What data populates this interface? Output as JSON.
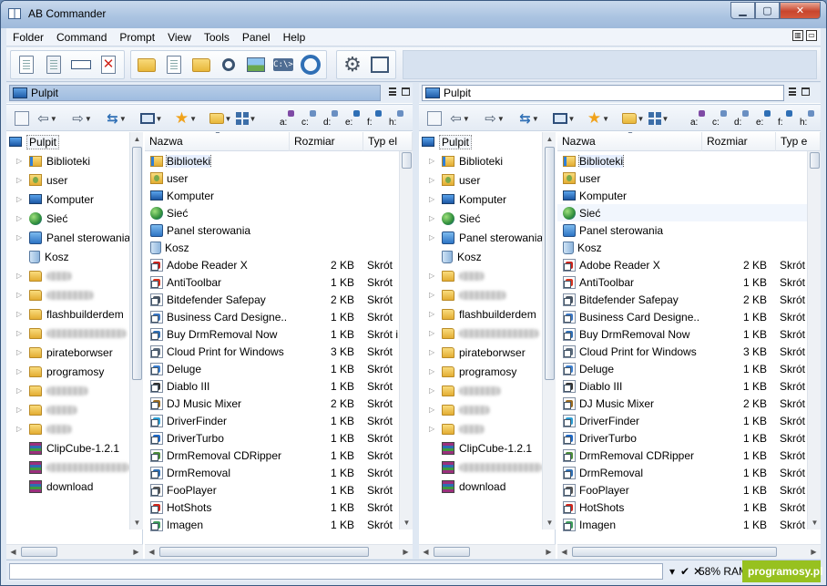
{
  "window": {
    "title": "AB Commander"
  },
  "menu": [
    "Folder",
    "Command",
    "Prompt",
    "View",
    "Tools",
    "Panel",
    "Help"
  ],
  "toolbar_icons": [
    "copy-icon",
    "copy-to-icon",
    "rename-icon",
    "delete-icon",
    "move-up-icon",
    "properties-icon",
    "new-folder-icon",
    "find-icon",
    "image-viewer-icon",
    "command-prompt-icon",
    "sync-icon",
    "settings-icon",
    "fullscreen-icon"
  ],
  "drives": [
    "a:",
    "c:",
    "d:",
    "e:",
    "f:",
    "h:"
  ],
  "left": {
    "path": "Pulpit",
    "tree_root": "Pulpit",
    "tree": [
      "Biblioteki",
      "user",
      "Komputer",
      "Sieć",
      "Panel sterowania",
      "Kosz",
      "",
      "",
      "flashbuilderdem",
      "",
      "pirateborwser",
      "programosy",
      "",
      "",
      "",
      "ClipCube-1.2.1",
      "",
      "download"
    ],
    "columns": [
      "Nazwa",
      "Rozmiar",
      "Typ el"
    ]
  },
  "right": {
    "path": "Pulpit",
    "tree_root": "Pulpit",
    "tree": [
      "Biblioteki",
      "user",
      "Komputer",
      "Sieć",
      "Panel sterowania",
      "Kosz",
      "",
      "",
      "flashbuilderdem",
      "",
      "pirateborwser",
      "programosy",
      "",
      "",
      "",
      "ClipCube-1.2.1",
      "",
      "download"
    ],
    "columns": [
      "Nazwa",
      "Rozmiar",
      "Typ e"
    ]
  },
  "files": [
    {
      "name": "Biblioteki",
      "size": "",
      "type": "",
      "icon": "libs"
    },
    {
      "name": "user",
      "size": "",
      "type": "",
      "icon": "user"
    },
    {
      "name": "Komputer",
      "size": "",
      "type": "",
      "icon": "comp"
    },
    {
      "name": "Sieć",
      "size": "",
      "type": "",
      "icon": "net"
    },
    {
      "name": "Panel sterowania",
      "size": "",
      "type": "",
      "icon": "ctrl"
    },
    {
      "name": "Kosz",
      "size": "",
      "type": "",
      "icon": "bin"
    },
    {
      "name": "Adobe Reader X",
      "size": "2 KB",
      "type": "Skrót",
      "icon": "app",
      "color": "#c9231b"
    },
    {
      "name": "AntiToolbar",
      "size": "1 KB",
      "type": "Skrót",
      "icon": "app",
      "color": "#d8341f"
    },
    {
      "name": "Bitdefender Safepay",
      "size": "2 KB",
      "type": "Skrót",
      "icon": "app",
      "color": "#4a5563"
    },
    {
      "name": "Business Card Designe...",
      "size": "1 KB",
      "type": "Skrót",
      "icon": "app",
      "color": "#3a76c4"
    },
    {
      "name": "Buy DrmRemoval Now",
      "size": "1 KB",
      "type": "Skrót i",
      "icon": "app",
      "color": "#2f6fb5"
    },
    {
      "name": "Cloud Print for Windows",
      "size": "3 KB",
      "type": "Skrót",
      "icon": "app",
      "color": "#5b6b7d"
    },
    {
      "name": "Deluge",
      "size": "1 KB",
      "type": "Skrót",
      "icon": "app",
      "color": "#3b7fd0"
    },
    {
      "name": "Diablo III",
      "size": "1 KB",
      "type": "Skrót",
      "icon": "app",
      "color": "#333"
    },
    {
      "name": "DJ Music Mixer",
      "size": "2 KB",
      "type": "Skrót",
      "icon": "app",
      "color": "#9a6a1e"
    },
    {
      "name": "DriverFinder",
      "size": "1 KB",
      "type": "Skrót",
      "icon": "app",
      "color": "#2a9fd6"
    },
    {
      "name": "DriverTurbo",
      "size": "1 KB",
      "type": "Skrót",
      "icon": "app",
      "color": "#1d69c9"
    },
    {
      "name": "DrmRemoval CDRipper",
      "size": "1 KB",
      "type": "Skrót",
      "icon": "app",
      "color": "#4b8c3a"
    },
    {
      "name": "DrmRemoval",
      "size": "1 KB",
      "type": "Skrót",
      "icon": "app",
      "color": "#2f6fb5"
    },
    {
      "name": "FooPlayer",
      "size": "1 KB",
      "type": "Skrót",
      "icon": "app",
      "color": "#555"
    },
    {
      "name": "HotShots",
      "size": "1 KB",
      "type": "Skrót",
      "icon": "app",
      "color": "#d0261c"
    },
    {
      "name": "Imagen",
      "size": "1 KB",
      "type": "Skrót",
      "icon": "app",
      "color": "#3c9b5a"
    }
  ],
  "status": {
    "ram": "58% RAM",
    "watermark": "programosy.pl"
  }
}
